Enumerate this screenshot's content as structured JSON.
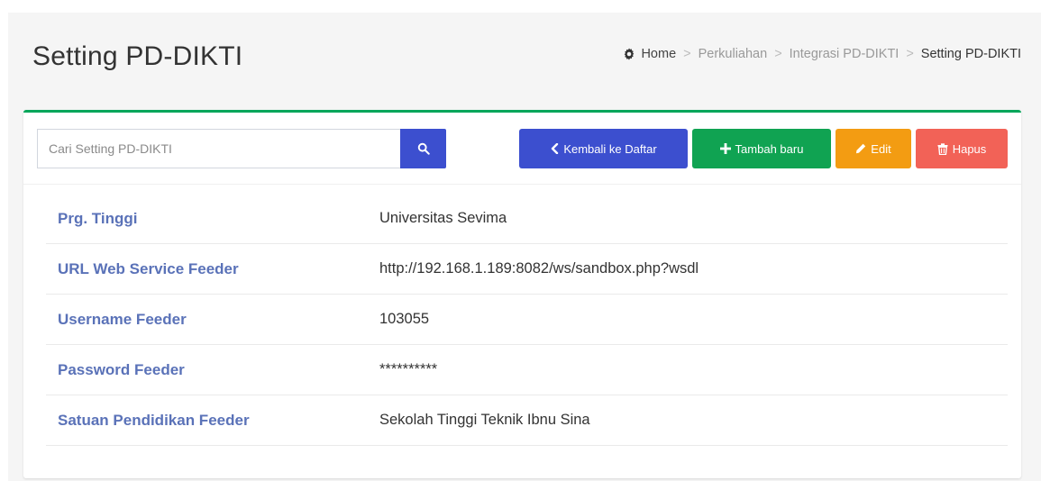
{
  "page": {
    "title": "Setting PD-DIKTI"
  },
  "breadcrumb": {
    "home": "Home",
    "items": [
      "Perkuliahan",
      "Integrasi PD-DIKTI"
    ],
    "current": "Setting PD-DIKTI",
    "separator": ">",
    "icon": "gear-icon"
  },
  "search": {
    "placeholder": "Cari Setting PD-DIKTI",
    "value": "",
    "icon": "search-icon"
  },
  "toolbar": {
    "back_label": "Kembali ke Daftar",
    "add_label": "Tambah baru",
    "edit_label": "Edit",
    "delete_label": "Hapus"
  },
  "details": [
    {
      "label": "Prg. Tinggi",
      "value": "Universitas Sevima"
    },
    {
      "label": "URL Web Service Feeder",
      "value": "http://192.168.1.189:8082/ws/sandbox.php?wsdl"
    },
    {
      "label": "Username Feeder",
      "value": "103055"
    },
    {
      "label": "Password Feeder",
      "value": "**********"
    },
    {
      "label": "Satuan Pendidikan Feeder",
      "value": "Sekolah Tinggi Teknik Ibnu Sina"
    }
  ],
  "colors": {
    "primary": "#3c4fcf",
    "success": "#10a352",
    "warning": "#f39c12",
    "danger": "#f26257",
    "box_top_border": "#00a65a",
    "label": "#5a72b8"
  }
}
